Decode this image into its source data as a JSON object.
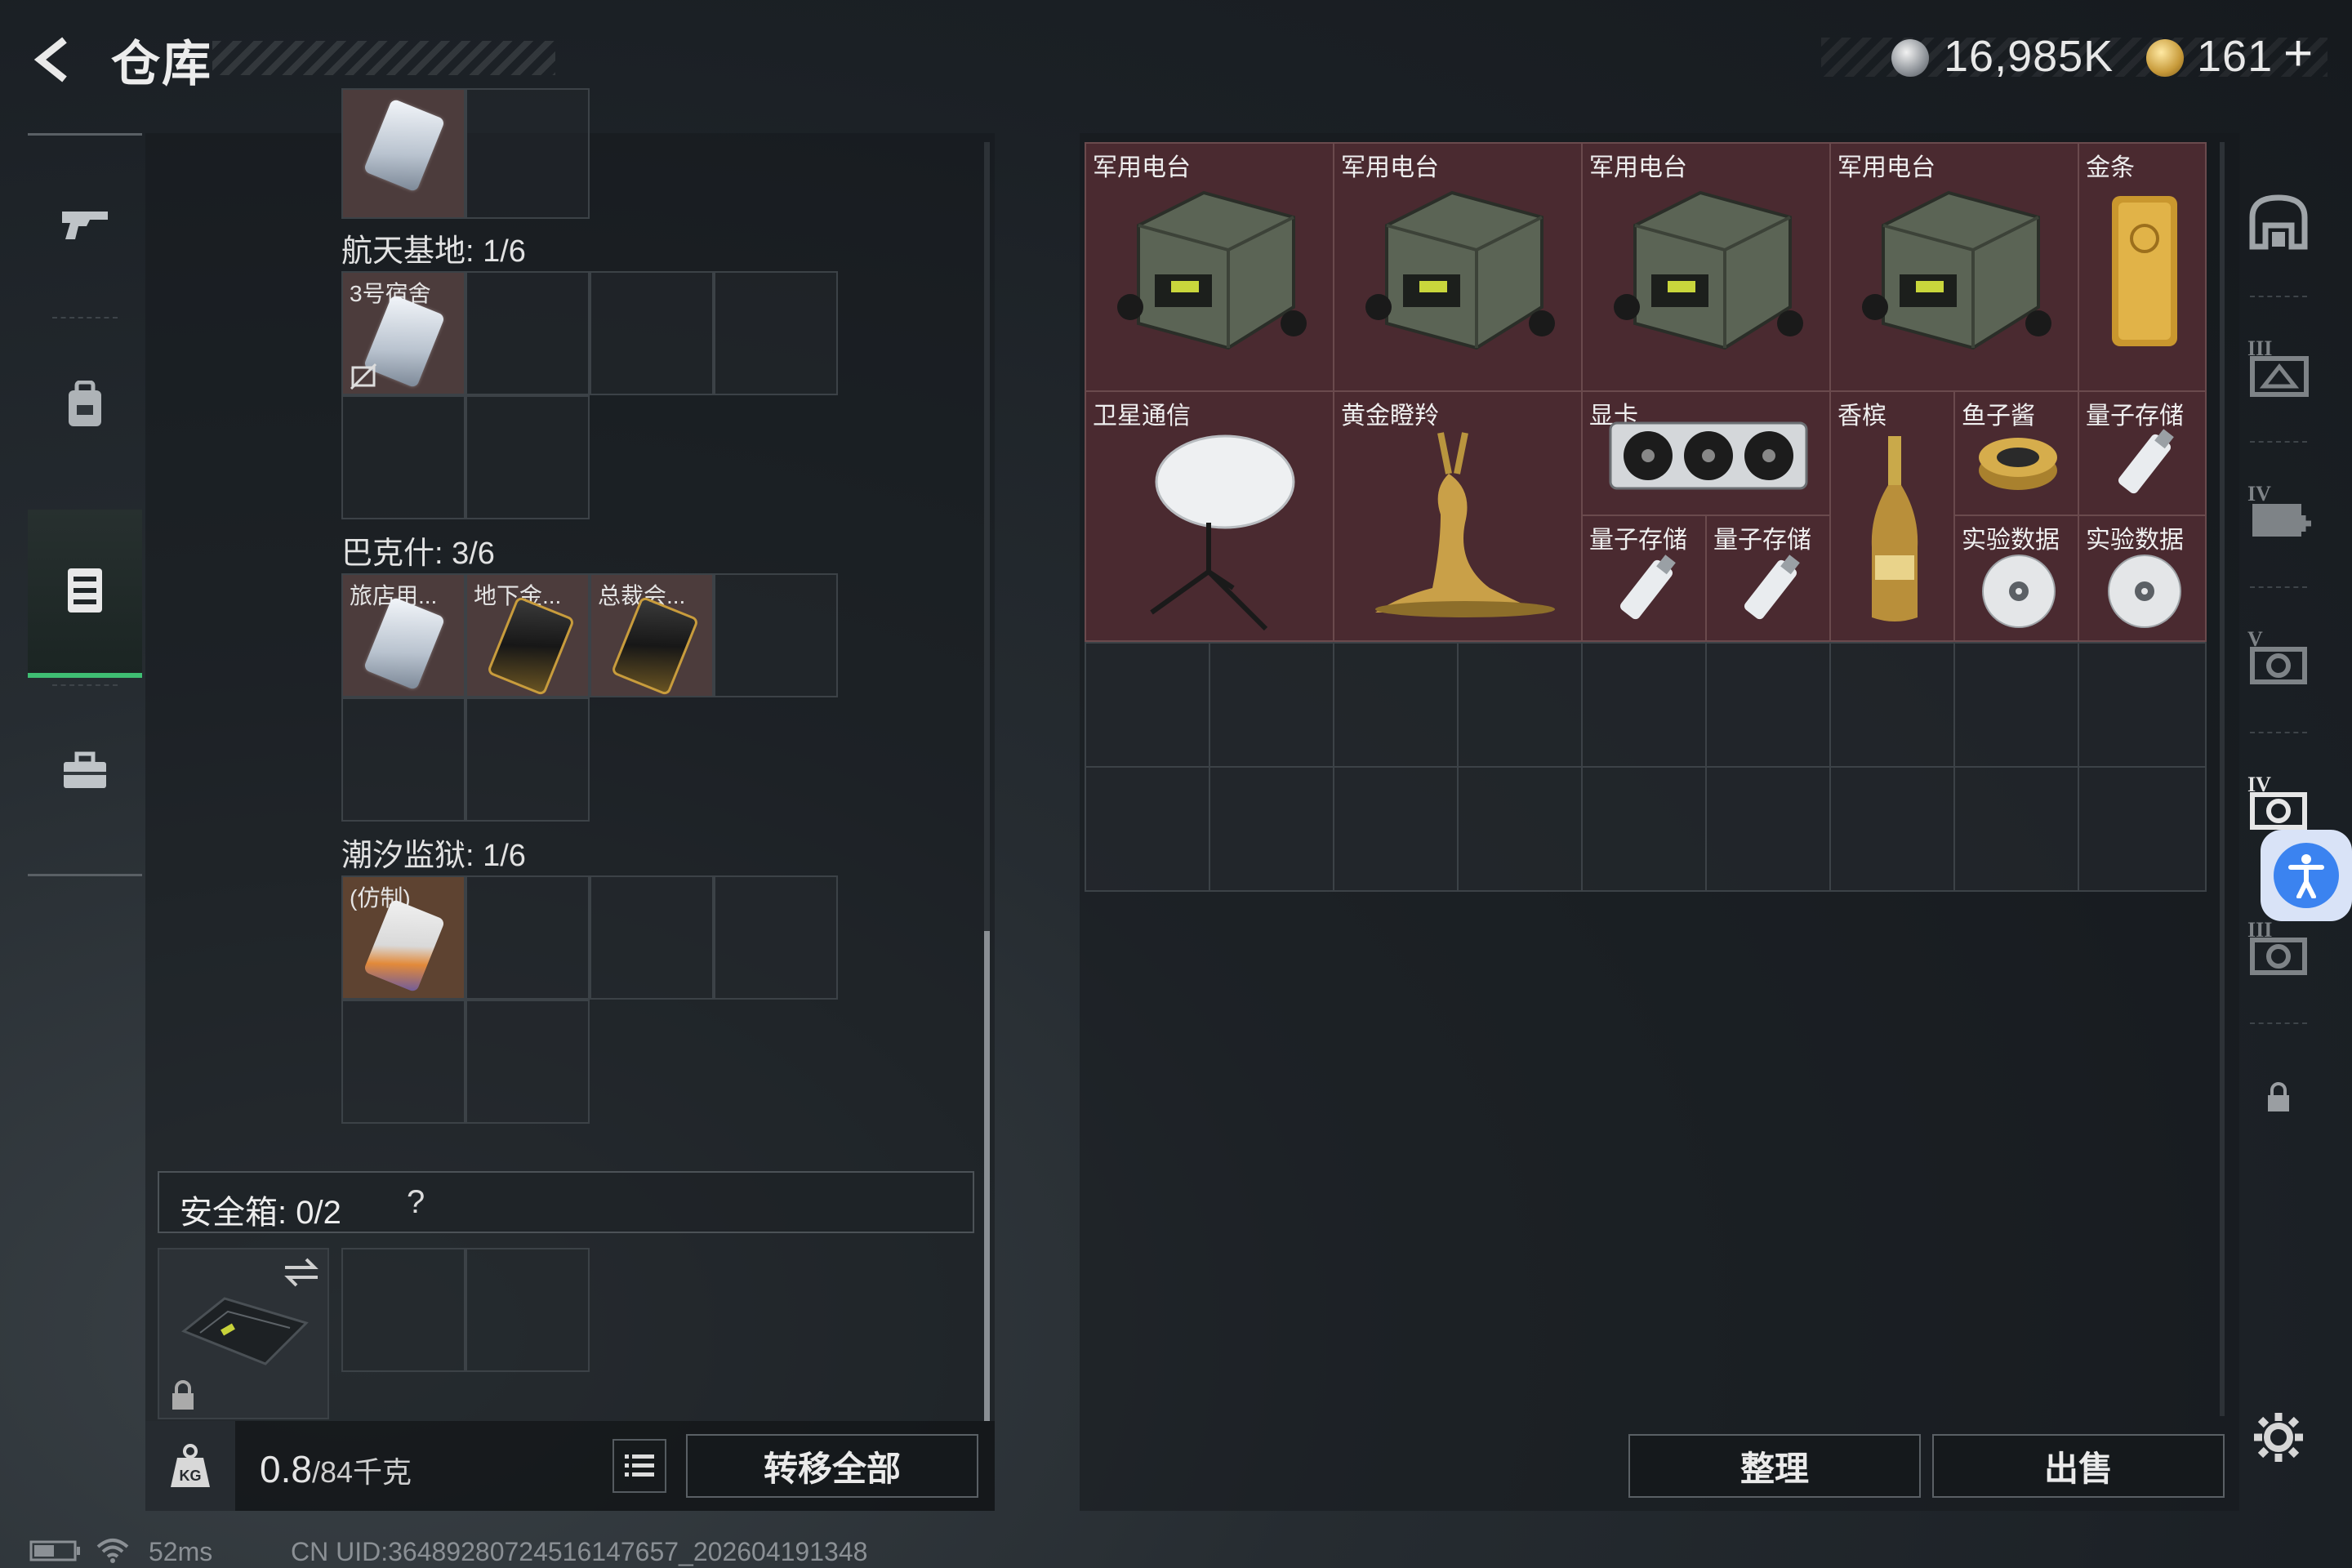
{
  "header": {
    "title": "仓库"
  },
  "currency": {
    "silver": "16,985K",
    "gold": "161",
    "plus": "+"
  },
  "left_groups": [
    {
      "label": "航天基地: 1/6",
      "items": [
        "3号宿舍"
      ]
    },
    {
      "label": "巴克什: 3/6",
      "items": [
        "旅店用...",
        "地下金...",
        "总裁会..."
      ]
    },
    {
      "label": "潮汐监狱: 1/6",
      "items": [
        "(仿制)"
      ]
    }
  ],
  "safebox": {
    "label": "安全箱: 0/2",
    "help": "?"
  },
  "weight": {
    "value": "0.8",
    "unit": "/84千克"
  },
  "buttons": {
    "transfer_all": "转移全部",
    "sort": "整理",
    "sell": "出售"
  },
  "stash_items": [
    {
      "name": "军用电台",
      "icon": "radio-icon"
    },
    {
      "name": "军用电台",
      "icon": "radio-icon"
    },
    {
      "name": "军用电台",
      "icon": "radio-icon"
    },
    {
      "name": "军用电台",
      "icon": "radio-icon"
    },
    {
      "name": "金条",
      "icon": "gold-bar-icon"
    },
    {
      "name": "卫星通信",
      "icon": "satellite-dish-icon"
    },
    {
      "name": "黄金瞪羚",
      "icon": "golden-gazelle-icon"
    },
    {
      "name": "显卡",
      "icon": "graphics-card-icon"
    },
    {
      "name": "香槟",
      "icon": "champagne-icon"
    },
    {
      "name": "鱼子酱",
      "icon": "caviar-icon"
    },
    {
      "name": "量子存储",
      "icon": "usb-drive-icon"
    },
    {
      "name": "量子存储",
      "icon": "usb-drive-icon"
    },
    {
      "name": "量子存储",
      "icon": "usb-drive-icon"
    },
    {
      "name": "实验数据",
      "icon": "disc-icon"
    },
    {
      "name": "实验数据",
      "icon": "disc-icon"
    }
  ],
  "right_nav": [
    "warehouse-icon",
    "tier-3-container-icon",
    "tier-4-medkit-icon",
    "tier-5-camera-icon",
    "tier-4-camera-icon",
    "tier-3-camera-icon",
    "lock-icon"
  ],
  "status": {
    "ping": "52ms",
    "uid": "CN UID:3648928072451614765​7_202604191348"
  },
  "colors": {
    "accent_green": "#3fbf73",
    "item_red": "#4a2a30",
    "access_blue": "#3b83f0"
  }
}
